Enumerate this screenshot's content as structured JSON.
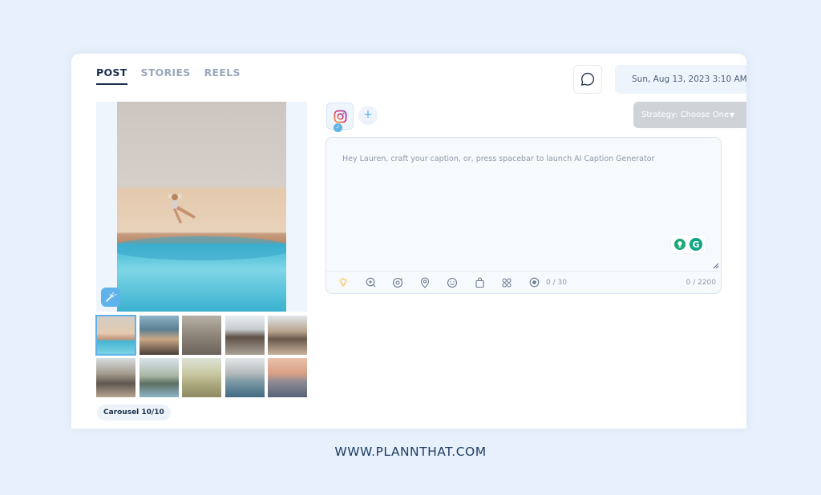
{
  "tabs": [
    {
      "label": "POST",
      "active": true
    },
    {
      "label": "STORIES",
      "active": false
    },
    {
      "label": "REELS",
      "active": false
    }
  ],
  "header": {
    "chat_icon": "chat-bubble-icon",
    "datetime": "Sun, Aug 13, 2023 3:10 AM"
  },
  "accounts": {
    "selected_icon": "instagram-icon",
    "add_label": "+"
  },
  "strategy": {
    "label": "Strategy: Choose One",
    "caret": "▼"
  },
  "caption": {
    "placeholder": "Hey Lauren, craft your caption, or, press spacebar to launch AI Caption Generator",
    "value": "",
    "hashtag_counter": "0 / 30",
    "char_counter": "0 / 2200"
  },
  "media": {
    "thumbnail_count": 10,
    "selected_index": 0,
    "carousel_badge": "Carousel 10/10"
  },
  "colors": {
    "accent": "#5fb3ea",
    "dark_text": "#1b2f4d",
    "background": "#e8f1fb"
  },
  "footer": {
    "url": "WWW.PLANNTHAT.COM"
  }
}
